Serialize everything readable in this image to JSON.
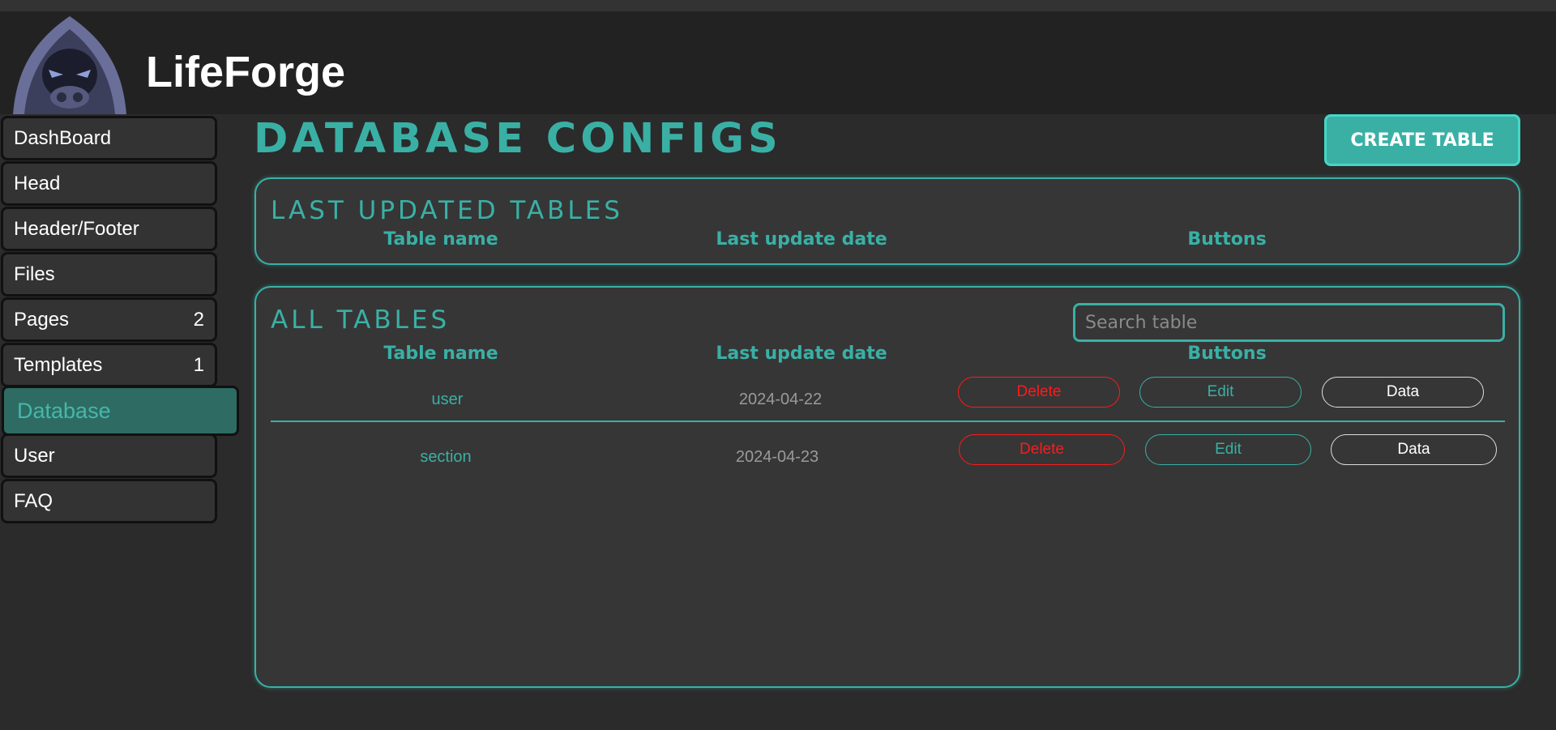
{
  "app": {
    "title": "LifeForge"
  },
  "sidebar": {
    "items": [
      {
        "label": "DashBoard",
        "count": ""
      },
      {
        "label": "Head",
        "count": ""
      },
      {
        "label": "Header/Footer",
        "count": ""
      },
      {
        "label": "Files",
        "count": ""
      },
      {
        "label": "Pages",
        "count": "2"
      },
      {
        "label": "Templates",
        "count": "1"
      },
      {
        "label": "Database",
        "count": ""
      },
      {
        "label": "User",
        "count": ""
      },
      {
        "label": "FAQ",
        "count": ""
      }
    ],
    "active": "Database"
  },
  "page": {
    "title": "DATABASE CONFIGS",
    "create_button": "CREATE TABLE"
  },
  "last_updated": {
    "title": "LAST UPDATED TABLES",
    "columns": [
      "Table name",
      "Last update date",
      "Buttons"
    ],
    "rows": []
  },
  "all_tables": {
    "title": "ALL TABLES",
    "search_placeholder": "Search table",
    "columns": [
      "Table name",
      "Last update date",
      "Buttons"
    ],
    "rows": [
      {
        "name": "user",
        "date": "2024-04-22",
        "delete": "Delete",
        "edit": "Edit",
        "data": "Data"
      },
      {
        "name": "section",
        "date": "2024-04-23",
        "delete": "Delete",
        "edit": "Edit",
        "data": "Data"
      }
    ]
  },
  "colors": {
    "accent": "#3ab0a5",
    "danger": "#ff1a1a",
    "background": "#2b2b2b",
    "panel": "#363636"
  }
}
